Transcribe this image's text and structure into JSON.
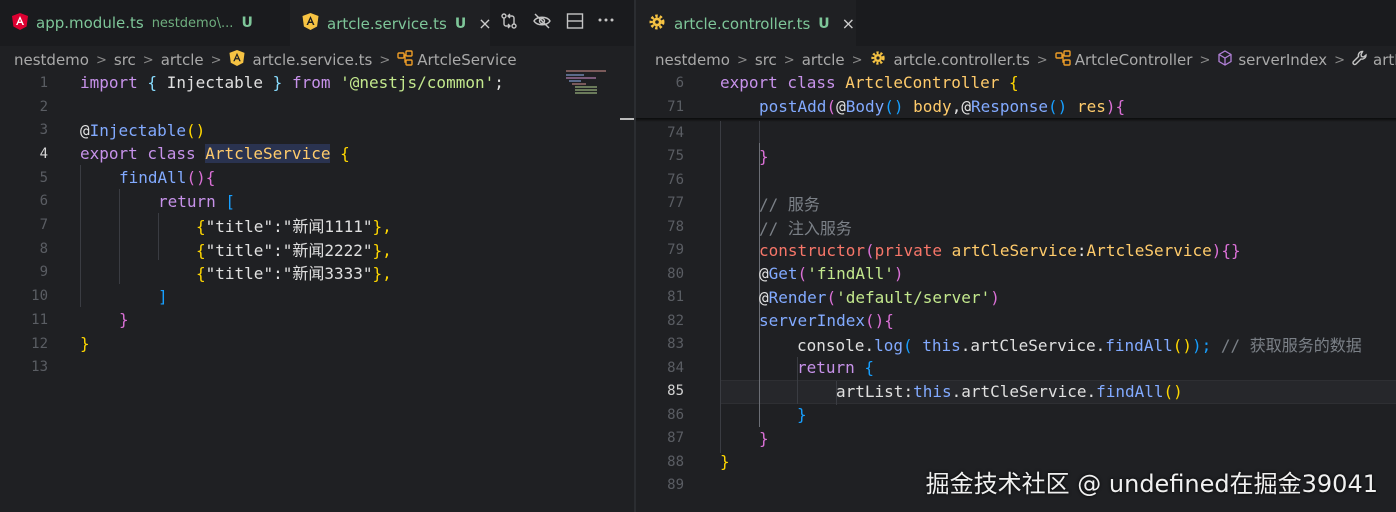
{
  "colors": {
    "background": "#1f2023",
    "tab_bar": "#1a1b1e",
    "git_untracked": "#7ec699",
    "keyword": "#f77669",
    "string": "#c3e88d",
    "function": "#82aaff",
    "class": "#ffcb6b",
    "comment": "#7b8087"
  },
  "left": {
    "tabs": [
      {
        "icon": "angular-icon",
        "name": "app.module.ts",
        "path": "nestdemo\\...",
        "status": "U"
      },
      {
        "icon": "angular-service-icon",
        "name": "artcle.service.ts",
        "status": "U",
        "close": "×"
      }
    ],
    "toolbar": [
      "compare-changes-icon",
      "toggle-visibility-icon",
      "split-editor-icon",
      "more-actions-icon"
    ],
    "breadcrumb": [
      "nestdemo",
      "src",
      "artcle",
      "artcle.service.ts",
      "ArtcleService"
    ],
    "code": {
      "ln": [
        "1",
        "2",
        "3",
        "4",
        "5",
        "6",
        "7",
        "8",
        "9",
        "10",
        "11",
        "12",
        "13"
      ],
      "l1": {
        "a": "import",
        "b": " { ",
        "c": "Injectable",
        "d": " } ",
        "e": "from",
        "f": " '@nestjs/common'",
        "g": ";"
      },
      "l3": {
        "a": "@",
        "b": "Injectable",
        "c": "()"
      },
      "l4": {
        "a": "export",
        "b": " class ",
        "c": "ArtcleService",
        "d": " {"
      },
      "l5": {
        "a": "findAll",
        "b": "(){"
      },
      "l6": {
        "a": "return",
        "b": " ["
      },
      "l7": {
        "a": "{",
        "b": "\"title\"",
        "c": ":",
        "d": "\"新闻1111\"",
        "e": "},"
      },
      "l8": {
        "a": "{",
        "b": "\"title\"",
        "c": ":",
        "d": "\"新闻2222\"",
        "e": "},"
      },
      "l9": {
        "a": "{",
        "b": "\"title\"",
        "c": ":",
        "d": "\"新闻3333\"",
        "e": "},"
      },
      "l10": {
        "a": "]"
      },
      "l11": {
        "a": "}"
      },
      "l12": {
        "a": "}"
      }
    }
  },
  "right": {
    "tab": {
      "icon": "gear-icon",
      "name": "artcle.controller.ts",
      "status": "U",
      "close": "×"
    },
    "breadcrumb": [
      "nestdemo",
      "src",
      "artcle",
      "artcle.controller.ts",
      "ArtcleController",
      "serverIndex",
      "artList"
    ],
    "code": {
      "ln": [
        "6",
        "71",
        "74",
        "75",
        "76",
        "77",
        "78",
        "79",
        "80",
        "81",
        "82",
        "83",
        "84",
        "85",
        "86",
        "87",
        "88",
        "89"
      ],
      "s1": {
        "a": "export",
        "b": " class ",
        "c": "ArtcleController",
        "d": " {"
      },
      "s2": {
        "a": "postAdd",
        "b": "(",
        "c": "@",
        "d": "Body",
        "e": "() ",
        "f": "body",
        "g": ",",
        "h": "@",
        "i": "Response",
        "j": "() ",
        "k": "res",
        "l": ")",
        "m": "{"
      },
      "l75": {
        "a": "}"
      },
      "l77": {
        "a": "// 服务"
      },
      "l78": {
        "a": "// 注入服务"
      },
      "l79": {
        "a": "constructor",
        "b": "(",
        "c": "private",
        "d": " artCleService",
        "e": ":",
        "f": "ArtcleService",
        "g": ")",
        "h": "{}"
      },
      "l80": {
        "a": "@",
        "b": "Get",
        "c": "(",
        "d": "'findAll'",
        "e": ")"
      },
      "l81": {
        "a": "@",
        "b": "Render",
        "c": "(",
        "d": "'default/server'",
        "e": ")"
      },
      "l82": {
        "a": "serverIndex",
        "b": "(){"
      },
      "l83": {
        "a": "console",
        "b": ".",
        "c": "log",
        "d": "( ",
        "e": "this",
        "f": ".artCleService.",
        "g": "findAll",
        "h": "()",
        "i": ");",
        "j": " // 获取服务的数据"
      },
      "l84": {
        "a": "return",
        "b": " {"
      },
      "l85": {
        "a": "artList",
        "b": ":",
        "c": "this",
        "d": ".artCleService.",
        "e": "findAll",
        "f": "()"
      },
      "l86": {
        "a": "}"
      },
      "l87": {
        "a": "}"
      },
      "l88": {
        "a": "}"
      }
    }
  },
  "watermark": "掘金技术社区 @ undefined在掘金39041"
}
